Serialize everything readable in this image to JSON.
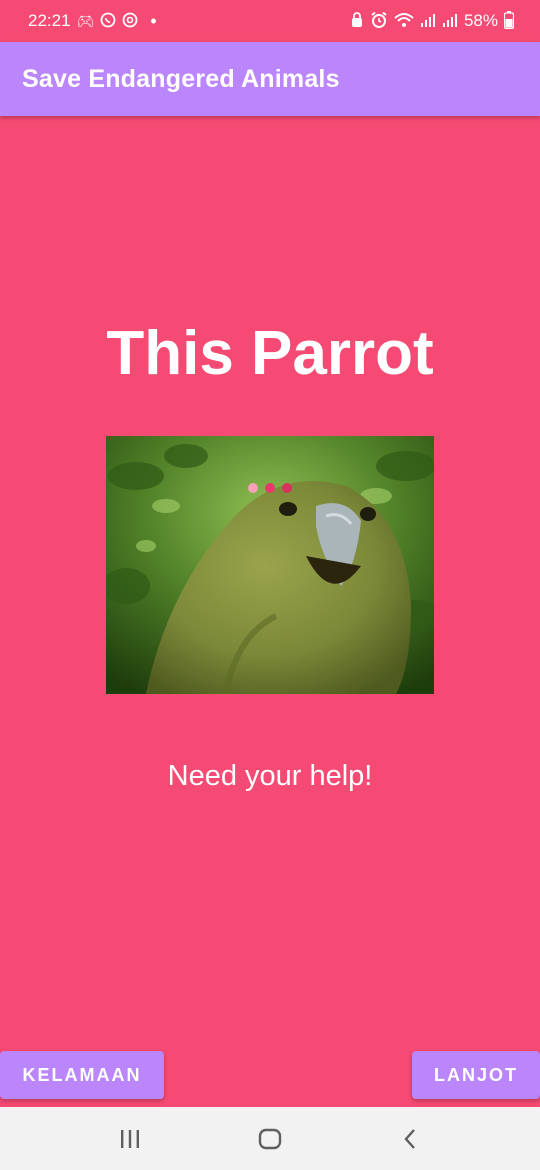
{
  "status_bar": {
    "time": "22:21",
    "battery": "58%",
    "icons_left": [
      "game-controller-icon",
      "whatsapp-icon",
      "mail-at-icon",
      "notification-dot-icon"
    ],
    "icons_right": [
      "lock-icon",
      "alarm-icon",
      "wifi-icon",
      "signal-icon",
      "signal-icon",
      "battery-icon"
    ]
  },
  "app_bar": {
    "title": "Save Endangered Animals"
  },
  "main": {
    "heading": "This Parrot",
    "subtext": "Need your help!",
    "loader_dot_colors": [
      "#f7a0b7",
      "#e63a6b",
      "#d8325f"
    ]
  },
  "buttons": {
    "back_label": "KELAMAAN",
    "next_label": "LANJOT"
  },
  "colors": {
    "background": "#f54a73",
    "accent": "#bb86fc",
    "nav_bar": "#f2f2f2"
  },
  "nav": {
    "items": [
      "recents-icon",
      "home-icon",
      "back-icon"
    ]
  }
}
